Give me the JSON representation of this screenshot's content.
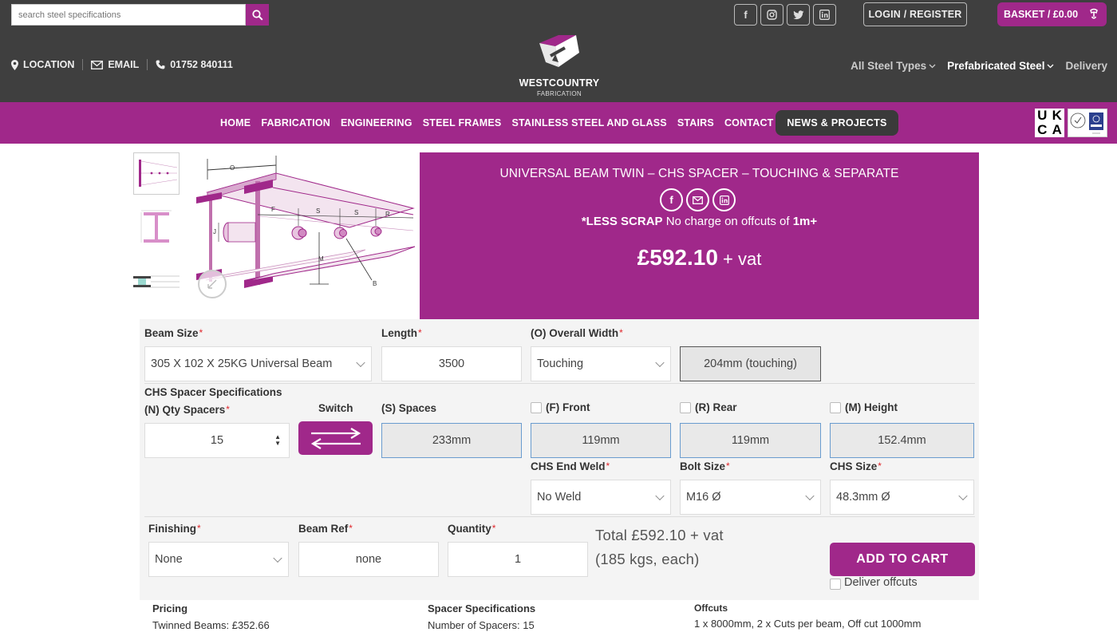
{
  "header": {
    "search_placeholder": "search steel specifications",
    "login_label": "LOGIN / REGISTER",
    "basket_label": "BASKET / £0.00",
    "contact": {
      "location": "LOCATION",
      "email": "EMAIL",
      "phone": "01752 840111"
    },
    "logo": {
      "name": "WESTCOUNTRY",
      "sub": "FABRICATION"
    },
    "right_nav": [
      "All Steel Types",
      "Prefabricated Steel",
      "Delivery"
    ]
  },
  "nav": {
    "links": [
      "HOME",
      "FABRICATION",
      "ENGINEERING",
      "STEEL FRAMES",
      "STAINLESS STEEL AND GLASS",
      "STAIRS",
      "CONTACT US"
    ],
    "cta": "NEWS & PROJECTS",
    "ukca": [
      "U",
      "K",
      "C",
      "A"
    ]
  },
  "diagram_labels": {
    "o": "O",
    "f": "F",
    "s1": "S",
    "s2": "S",
    "r": "R",
    "j": "J",
    "m": "M",
    "b": "B"
  },
  "product": {
    "title": "UNIVERSAL BEAM TWIN – CHS SPACER – TOUCHING & SEPARATE",
    "scrap_bold": "*LESS SCRAP",
    "scrap_text": " No charge on offcuts of ",
    "scrap_tail": "1m+",
    "price": "£592.10",
    "price_suffix": " + vat"
  },
  "form": {
    "beam_size": {
      "label": "Beam Size",
      "value": "305 X 102 X 25KG Universal Beam"
    },
    "length": {
      "label": "Length",
      "value": "3500"
    },
    "overall_width": {
      "label": "(O) Overall Width",
      "value": "Touching",
      "computed": "204mm (touching)"
    },
    "chs_heading": "CHS Spacer Specifications",
    "qty_spacers": {
      "label": "(N) Qty Spacers",
      "value": "15"
    },
    "switch_label": "Switch",
    "spaces": {
      "label": "(S) Spaces",
      "value": "233mm"
    },
    "front": {
      "label": "(F) Front",
      "value": "119mm"
    },
    "rear": {
      "label": "(R) Rear",
      "value": "119mm"
    },
    "height": {
      "label": "(M) Height",
      "value": "152.4mm"
    },
    "end_weld": {
      "label": "CHS End Weld",
      "value": "No Weld"
    },
    "bolt_size": {
      "label": "Bolt Size",
      "value": "M16 Ø"
    },
    "chs_size": {
      "label": "CHS Size",
      "value": "48.3mm Ø"
    },
    "finishing": {
      "label": "Finishing",
      "value": "None"
    },
    "beam_ref": {
      "label": "Beam Ref",
      "value": "none"
    },
    "quantity": {
      "label": "Quantity",
      "value": "1"
    },
    "total_line": "Total £592.10 + vat",
    "weight_line": "(185 kgs, each)",
    "add_to_cart": "ADD TO CART",
    "deliver_offcuts": "Deliver offcuts"
  },
  "specs": {
    "pricing_heading": "Pricing",
    "pricing_text": "Twinned Beams: £352.66",
    "spacer_heading": "Spacer Specifications",
    "spacer_text": "Number of Spacers: 15",
    "offcuts_heading": "Offcuts",
    "offcuts_text": "1 x 8000mm, 2 x Cuts per beam, Off cut 1000mm"
  },
  "colors": {
    "brand_purple": "#a0288a",
    "header_dark": "#3f3f3f",
    "required_red": "#e0262b"
  }
}
